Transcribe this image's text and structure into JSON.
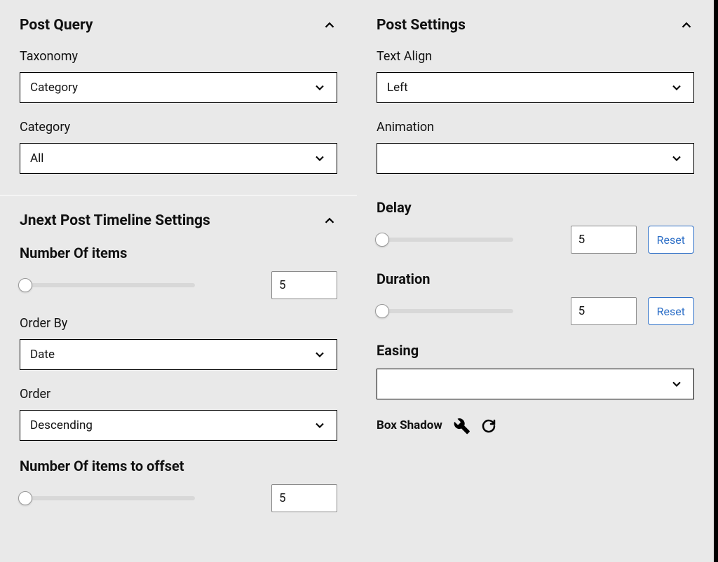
{
  "left": {
    "postQuery": {
      "title": "Post Query",
      "taxonomyLabel": "Taxonomy",
      "taxonomyValue": "Category",
      "categoryLabel": "Category",
      "categoryValue": "All"
    },
    "timelineSettings": {
      "title": "Jnext Post Timeline Settings",
      "numItemsLabel": "Number Of items",
      "numItemsValue": "5",
      "orderByLabel": "Order By",
      "orderByValue": "Date",
      "orderLabel": "Order",
      "orderValue": "Descending",
      "offsetLabel": "Number Of items to offset",
      "offsetValue": "5"
    }
  },
  "right": {
    "postSettings": {
      "title": "Post Settings",
      "textAlignLabel": "Text Align",
      "textAlignValue": "Left",
      "animationLabel": "Animation",
      "animationValue": "",
      "delayLabel": "Delay",
      "delayValue": "5",
      "delayReset": "Reset",
      "durationLabel": "Duration",
      "durationValue": "5",
      "durationReset": "Reset",
      "easingLabel": "Easing",
      "easingValue": "",
      "boxShadowLabel": "Box Shadow"
    }
  }
}
